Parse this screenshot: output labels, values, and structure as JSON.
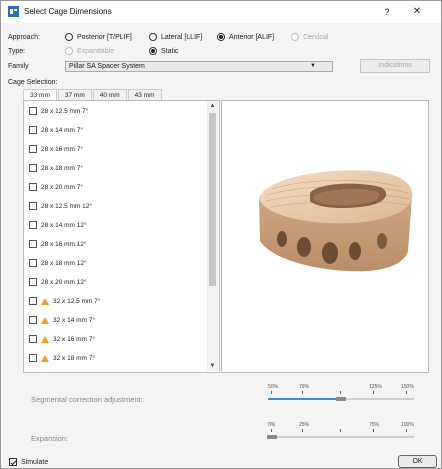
{
  "window": {
    "title": "Select Cage Dimensions",
    "help": "?",
    "close": "✕"
  },
  "approach": {
    "label": "Approach:",
    "options": [
      {
        "label": "Posterior [T/PLIF]",
        "checked": false,
        "disabled": false
      },
      {
        "label": "Lateral [LLIF]",
        "checked": false,
        "disabled": false
      },
      {
        "label": "Anterior [ALIF]",
        "checked": true,
        "disabled": false
      },
      {
        "label": "Cervical",
        "checked": false,
        "disabled": true
      }
    ]
  },
  "type": {
    "label": "Type:",
    "options": [
      {
        "label": "Expandable",
        "checked": false,
        "disabled": true
      },
      {
        "label": "Static",
        "checked": true,
        "disabled": false
      }
    ]
  },
  "family": {
    "label": "Family",
    "value": "Pillar SA Spacer System",
    "indications_label": "Indications"
  },
  "cage_selection": {
    "label": "Cage Selection:",
    "tabs": [
      "33 mm",
      "37 mm",
      "40 mm",
      "43 mm"
    ],
    "active_tab": 0,
    "items": [
      {
        "label": "28 x 12.5 mm 7°",
        "warning": false
      },
      {
        "label": "28 x 14 mm 7°",
        "warning": false
      },
      {
        "label": "28 x 16 mm 7°",
        "warning": false
      },
      {
        "label": "28 x 18 mm 7°",
        "warning": false
      },
      {
        "label": "28 x 20 mm 7°",
        "warning": false
      },
      {
        "label": "28 x 12.5 mm 12°",
        "warning": false
      },
      {
        "label": "28 x 14 mm 12°",
        "warning": false
      },
      {
        "label": "28 x 16 mm 12°",
        "warning": false
      },
      {
        "label": "28 x 18 mm 12°",
        "warning": false
      },
      {
        "label": "28 x 20 mm 12°",
        "warning": false
      },
      {
        "label": "32 x 12.5 mm 7°",
        "warning": true
      },
      {
        "label": "32 x 14 mm 7°",
        "warning": true
      },
      {
        "label": "32 x 16 mm 7°",
        "warning": true
      },
      {
        "label": "32 x 18 mm 7°",
        "warning": true
      }
    ]
  },
  "segmental": {
    "label": "Segmental correction adjustment:",
    "ticks": [
      "50%",
      "75%",
      "125%",
      "150%"
    ],
    "value_percent": 100
  },
  "expansion": {
    "label": "Expansion:",
    "ticks": [
      "0%",
      "25%",
      "75%",
      "100%"
    ],
    "value_percent": 0
  },
  "footer": {
    "simulate_label": "Simulate",
    "simulate_checked": true,
    "ok_label": "OK"
  },
  "colors": {
    "accent": "#3b8fd6",
    "warning": "#f0a020",
    "cage": "#e8c9a8"
  }
}
